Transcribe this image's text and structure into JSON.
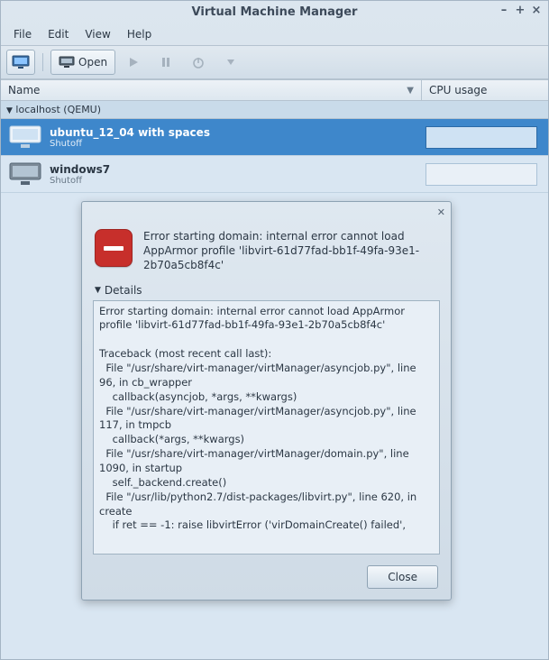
{
  "window": {
    "title": "Virtual Machine Manager"
  },
  "menubar": {
    "file": "File",
    "edit": "Edit",
    "view": "View",
    "help": "Help"
  },
  "toolbar": {
    "open_label": "Open"
  },
  "columns": {
    "name": "Name",
    "cpu": "CPU usage"
  },
  "connection": {
    "label": "localhost (QEMU)"
  },
  "vms": [
    {
      "name": "ubuntu_12_04 with spaces",
      "status": "Shutoff",
      "selected": true
    },
    {
      "name": "windows7",
      "status": "Shutoff",
      "selected": false
    }
  ],
  "dialog": {
    "summary": "Error starting domain: internal error cannot load AppArmor profile 'libvirt-61d77fad-bb1f-49fa-93e1-2b70a5cb8f4c'",
    "details_label": "Details",
    "details_text": "Error starting domain: internal error cannot load AppArmor profile 'libvirt-61d77fad-bb1f-49fa-93e1-2b70a5cb8f4c'\n\nTraceback (most recent call last):\n  File \"/usr/share/virt-manager/virtManager/asyncjob.py\", line 96, in cb_wrapper\n    callback(asyncjob, *args, **kwargs)\n  File \"/usr/share/virt-manager/virtManager/asyncjob.py\", line 117, in tmpcb\n    callback(*args, **kwargs)\n  File \"/usr/share/virt-manager/virtManager/domain.py\", line 1090, in startup\n    self._backend.create()\n  File \"/usr/lib/python2.7/dist-packages/libvirt.py\", line 620, in create\n    if ret == -1: raise libvirtError ('virDomainCreate() failed',",
    "close_label": "Close"
  }
}
